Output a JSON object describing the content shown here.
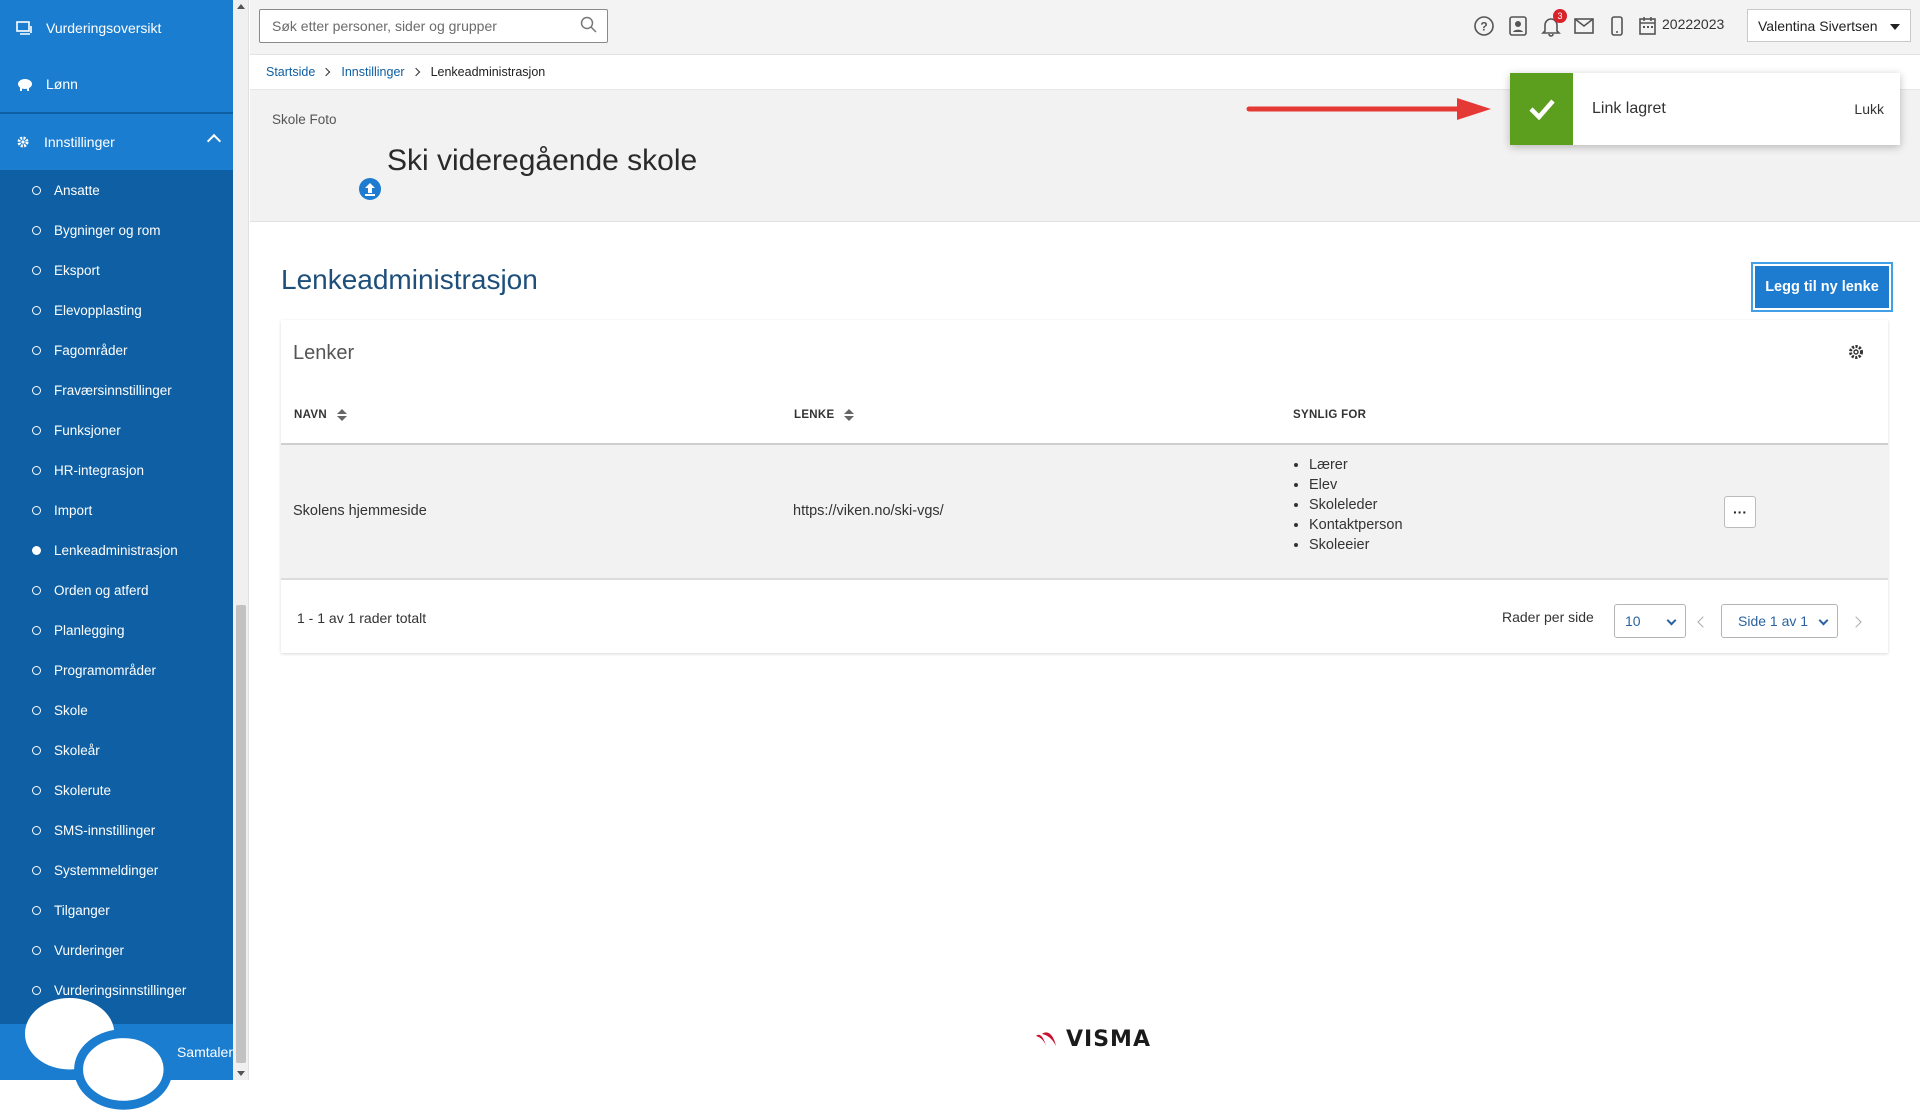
{
  "sidebar": {
    "top_items": [
      {
        "label": "Vurderingsoversikt",
        "icon": "assessment-icon"
      },
      {
        "label": "Lønn",
        "icon": "piggy-bank-icon"
      }
    ],
    "section": {
      "label": "Innstillinger",
      "icon": "gear-icon"
    },
    "sub_items": [
      "Ansatte",
      "Bygninger og rom",
      "Eksport",
      "Elevopplasting",
      "Fagområder",
      "Fraværsinnstillinger",
      "Funksjoner",
      "HR-integrasjon",
      "Import",
      "Lenkeadministrasjon",
      "Orden og atferd",
      "Planlegging",
      "Programområder",
      "Skole",
      "Skoleår",
      "Skolerute",
      "SMS-innstillinger",
      "Systemmeldinger",
      "Tilganger",
      "Vurderinger",
      "Vurderingsinnstillinger"
    ],
    "active_sub_item": "Lenkeadministrasjon",
    "bottom_item": {
      "label": "Samtaler",
      "icon": "chat-icon"
    }
  },
  "topbar": {
    "search_placeholder": "Søk etter personer, sider og grupper",
    "notifications_count": "3",
    "school_year": "20222023",
    "user_name": "Valentina Sivertsen",
    "icons": [
      "help-icon",
      "contact-card-icon",
      "bell-icon",
      "mail-icon",
      "phone-icon",
      "calendar-icon"
    ]
  },
  "breadcrumb": {
    "items": [
      "Startside",
      "Innstillinger"
    ],
    "current": "Lenkeadministrasjon"
  },
  "school": {
    "photo_alt": "Skole Foto",
    "name": "Ski videregående skole"
  },
  "toast": {
    "message": "Link lagret",
    "close_label": "Lukk",
    "color": "#5c9e1d"
  },
  "page": {
    "title": "Lenkeadministrasjon",
    "add_button": "Legg til ny lenke"
  },
  "table": {
    "title": "Lenker",
    "columns": [
      "NAVN",
      "LENKE",
      "SYNLIG FOR"
    ],
    "rows": [
      {
        "name": "Skolens hjemmeside",
        "link": "https://viken.no/ski-vgs/",
        "visible_for": [
          "Lærer",
          "Elev",
          "Skoleleder",
          "Kontaktperson",
          "Skoleeier"
        ],
        "menu": "···"
      }
    ],
    "summary": "1 - 1 av 1 rader totalt",
    "rows_per_page_label": "Rader per side",
    "rows_per_page": "10",
    "page_select": "Side 1 av 1"
  },
  "footer": {
    "brand": "VISMA"
  },
  "colors": {
    "sidebar": "#0e5fa3",
    "sidebar_header": "#1a7dcf",
    "accent": "#1d7bd0",
    "success": "#5c9e1d",
    "annotation_arrow": "#e53935"
  }
}
